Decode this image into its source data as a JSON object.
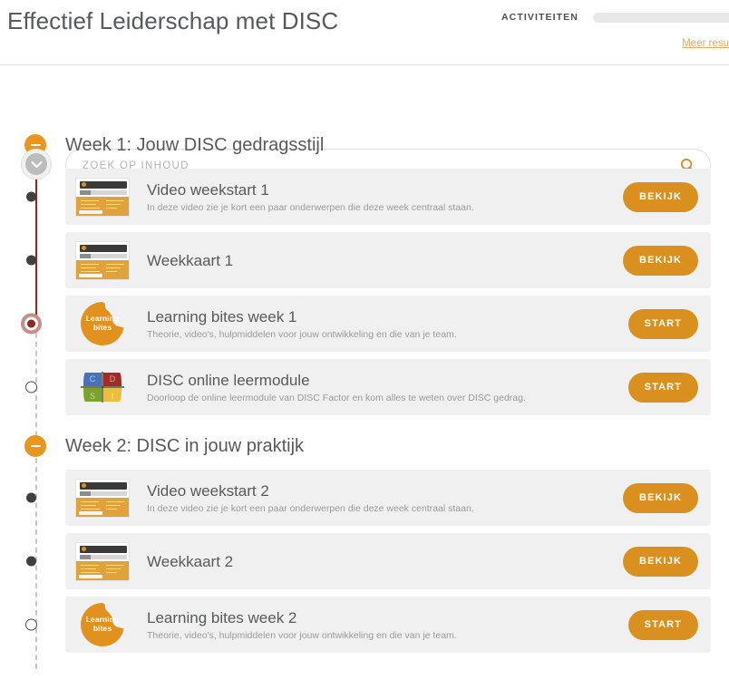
{
  "header": {
    "title": "Effectief Leiderschap met DISC",
    "activity_label": "ACTIVITEITEN",
    "progress_percent": 0,
    "more_results_link": "Meer resu",
    "accent_color": "#d9901f",
    "rail_color": "#8b2a1f"
  },
  "search": {
    "placeholder": "ZOEK OP INHOUD",
    "value": "",
    "icon": "search-icon"
  },
  "collapse_toggle": {
    "icon": "chevron-down-icon"
  },
  "weeks": [
    {
      "title": "Week 1: Jouw DISC gedragsstijl",
      "toggle_icon": "minus-icon",
      "items": [
        {
          "title": "Video weekstart 1",
          "description": "In deze video zie je kort een paar onderwerpen die deze week centraal staan.",
          "button": "BEKIJK",
          "thumb": "document-thumbnail",
          "status": "done"
        },
        {
          "title": "Weekkaart 1",
          "description": "",
          "button": "BEKIJK",
          "thumb": "document-thumbnail",
          "status": "done"
        },
        {
          "title": "Learning bites week 1",
          "description": "Theorie, video's, hulpmiddelen voor jouw ontwikkeling en die van je team.",
          "button": "START",
          "thumb": "learning-bites-icon",
          "thumb_text_line1": "Learning",
          "thumb_text_line2": "bites",
          "status": "current"
        },
        {
          "title": "DISC online leermodule",
          "description": "Doorloop de online leermodule van DISC Factor en kom alles te weten over DISC gedrag.",
          "button": "START",
          "thumb": "disc-quadrant-icon",
          "status": "todo"
        }
      ]
    },
    {
      "title": "Week 2: DISC in jouw praktijk",
      "toggle_icon": "minus-icon",
      "items": [
        {
          "title": "Video weekstart 2",
          "description": "In deze video zie je kort een paar onderwerpen die deze week centraal staan.",
          "button": "BEKIJK",
          "thumb": "document-thumbnail",
          "status": "done"
        },
        {
          "title": "Weekkaart 2",
          "description": "",
          "button": "BEKIJK",
          "thumb": "document-thumbnail",
          "status": "done"
        },
        {
          "title": "Learning bites week 2",
          "description": "Theorie, video's, hulpmiddelen voor jouw ontwikkeling en die van je team.",
          "button": "START",
          "thumb": "learning-bites-icon",
          "thumb_text_line1": "Learning",
          "thumb_text_line2": "bites",
          "status": "todo"
        }
      ]
    }
  ],
  "disc_icon": {
    "quadrants": [
      {
        "letter": "C",
        "color": "#4a72b8"
      },
      {
        "letter": "D",
        "color": "#a32b26"
      },
      {
        "letter": "S",
        "color": "#7aa32b"
      },
      {
        "letter": "I",
        "color": "#e8c03c"
      }
    ]
  }
}
